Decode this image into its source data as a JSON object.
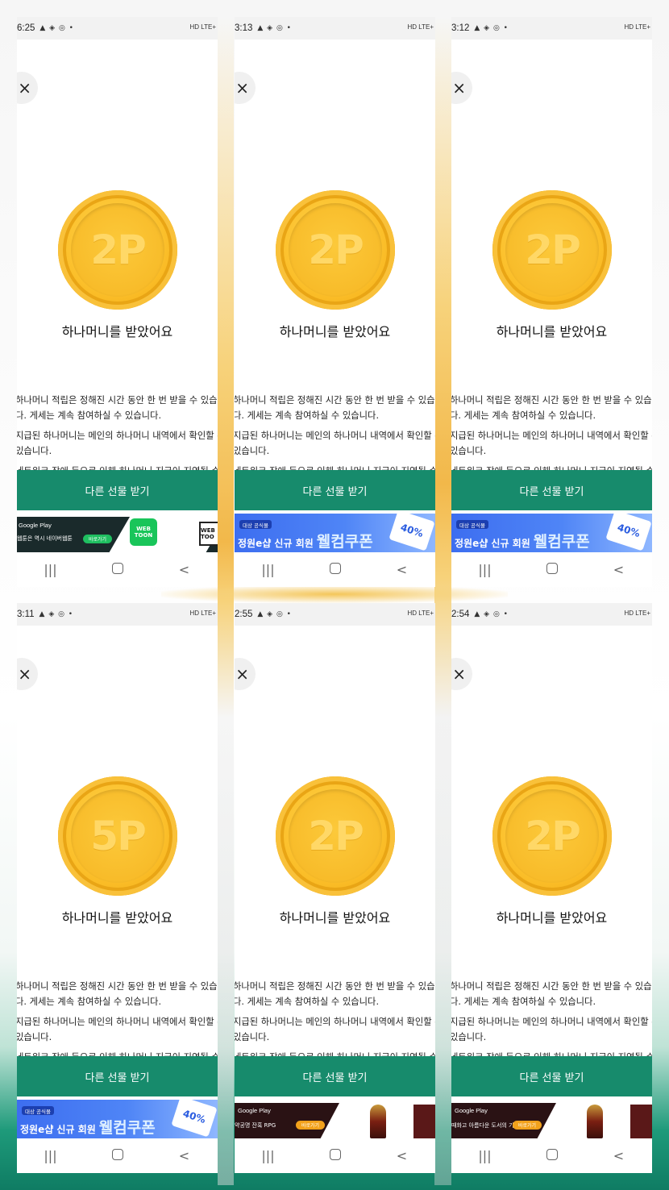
{
  "screens": [
    {
      "time": "6:25",
      "coin": "2P",
      "ad": "webtoon"
    },
    {
      "time": "3:13",
      "coin": "2P",
      "ad": "coupon"
    },
    {
      "time": "3:12",
      "coin": "2P",
      "ad": "coupon"
    },
    {
      "time": "3:11",
      "coin": "5P",
      "ad": "coupon"
    },
    {
      "time": "2:55",
      "coin": "2P",
      "ad": "game"
    },
    {
      "time": "2:54",
      "coin": "2P",
      "ad": "game"
    }
  ],
  "status": {
    "network": "HD LTE+"
  },
  "close_glyph": "×",
  "received_text": "하나머니를 받았어요",
  "desc_lines": [
    "하나머니 적립은 정해진 시간 동안 한 번 받을 수 있습니",
    "다. 게세는 계속 참여하실 수 있습니다.",
    "지급된 하나머니는 메인의 하나머니 내역에서 확인할 수",
    "있습니다.",
    "네트워크 장애 등으로 인해 하나머니 지급이 지연될 수"
  ],
  "cta_label": "다른 선물 받기",
  "ads": {
    "webtoon": {
      "store": "Google Play",
      "tagline": "웹툰은 역시 네이버웹툰",
      "button": "바로가기",
      "logo": "WEB TOON",
      "logo2": "WEB TOO"
    },
    "coupon": {
      "pill": "대상 공식몰",
      "text": "정원e샵 신규 회원",
      "welcome": "웰컴쿠폰",
      "ticket": "40%"
    },
    "game": {
      "store": "Google Play",
      "tagline": "약공명 잔혹 RPG",
      "tagline2": "때화고 아름다운 도서의 기록",
      "button": "바로가기"
    }
  },
  "nav": {
    "recent": "|||",
    "back": "<"
  },
  "colors": {
    "cta": "#178b6c",
    "coin": "#fbbf2a",
    "accent_glow": "#f2b84a"
  }
}
